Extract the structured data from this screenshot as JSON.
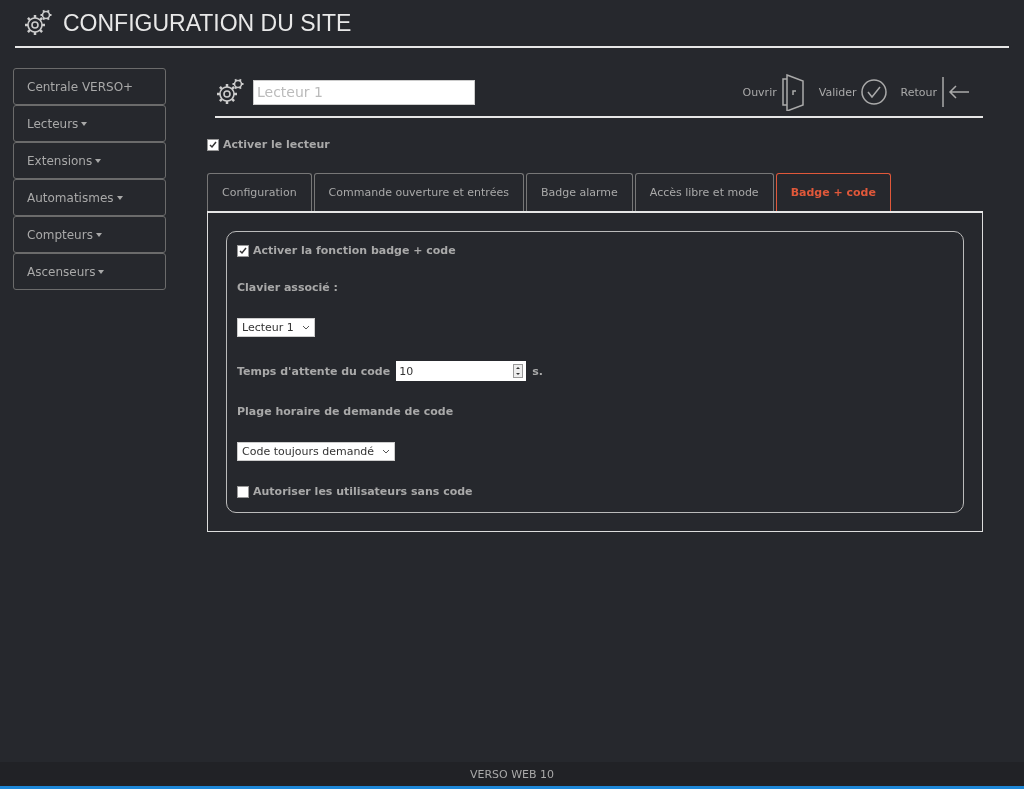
{
  "header": {
    "title": "CONFIGURATION DU SITE"
  },
  "sidebar": {
    "items": [
      {
        "label": "Centrale VERSO+",
        "has_menu": false
      },
      {
        "label": "Lecteurs",
        "has_menu": true
      },
      {
        "label": "Extensions",
        "has_menu": true
      },
      {
        "label": "Automatismes",
        "has_menu": true
      },
      {
        "label": "Compteurs",
        "has_menu": true
      },
      {
        "label": "Ascenseurs",
        "has_menu": true
      }
    ]
  },
  "reader": {
    "name_field": {
      "placeholder": "Lecteur 1"
    },
    "actions": [
      {
        "kind": "open",
        "label": "Ouvrir"
      },
      {
        "kind": "validate",
        "label": "Valider"
      },
      {
        "kind": "back",
        "label": "Retour"
      }
    ],
    "enable": {
      "label": "Activer le lecteur",
      "checked": true
    }
  },
  "tabs": [
    {
      "label": "Configuration",
      "selected": false
    },
    {
      "label": "Commande ouverture et entrées",
      "selected": false
    },
    {
      "label": "Badge alarme",
      "selected": false
    },
    {
      "label": "Accès libre et mode",
      "selected": false
    },
    {
      "label": "Badge + code",
      "selected": true
    }
  ],
  "panel": {
    "rows": [
      {
        "kind": "checkbox",
        "label": "Activer la fonction badge + code",
        "checked": true
      },
      {
        "kind": "label",
        "label": "Clavier associé :"
      },
      {
        "kind": "select",
        "value": "Lecteur 1"
      },
      {
        "kind": "number",
        "label": "Temps d'attente du code",
        "value": "10",
        "unit": "s."
      },
      {
        "kind": "label",
        "label": "Plage horaire de demande de code"
      },
      {
        "kind": "select",
        "value": "Code toujours demandé"
      },
      {
        "kind": "checkbox",
        "label": "Autoriser les utilisateurs sans code",
        "checked": false
      }
    ]
  },
  "footer": {
    "text": "VERSO WEB 10"
  }
}
